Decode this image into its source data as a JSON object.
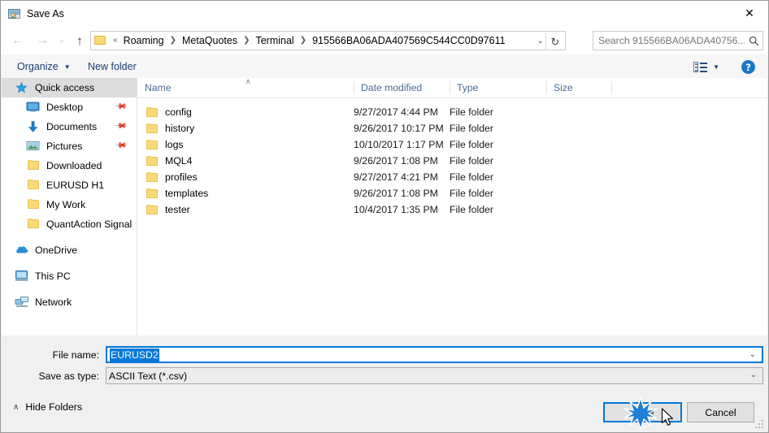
{
  "window": {
    "title": "Save As",
    "icon": "save-as-icon",
    "close_label": "✕"
  },
  "navigation": {
    "back_icon": "←",
    "forward_icon": "→",
    "recent_icon": "⌄",
    "up_icon": "↑",
    "breadcrumb": {
      "overflow": "«",
      "separator": "❯",
      "items": [
        "Roaming",
        "MetaQuotes",
        "Terminal",
        "915566BA06ADA407569C544CC0D97611"
      ],
      "dropdown_icon": "⌄",
      "refresh_icon": "↻"
    },
    "search": {
      "placeholder": "Search 915566BA06ADA40756...",
      "icon": "search-icon"
    }
  },
  "toolbar": {
    "organize_label": "Organize",
    "organize_caret": "▼",
    "new_folder_label": "New folder",
    "view_caret": "▼",
    "help_label": "?"
  },
  "sidebar": {
    "items": [
      {
        "label": "Quick access",
        "icon": "star-icon",
        "selected": true,
        "indent": false,
        "pinned": false
      },
      {
        "label": "Desktop",
        "icon": "desktop-icon",
        "selected": false,
        "indent": true,
        "pinned": true
      },
      {
        "label": "Documents",
        "icon": "documents-icon",
        "selected": false,
        "indent": true,
        "pinned": true
      },
      {
        "label": "Pictures",
        "icon": "pictures-icon",
        "selected": false,
        "indent": true,
        "pinned": true
      },
      {
        "label": "Downloaded",
        "icon": "folder-icon",
        "selected": false,
        "indent": true,
        "pinned": false
      },
      {
        "label": "EURUSD H1",
        "icon": "folder-icon",
        "selected": false,
        "indent": true,
        "pinned": false
      },
      {
        "label": "My Work",
        "icon": "folder-icon",
        "selected": false,
        "indent": true,
        "pinned": false
      },
      {
        "label": "QuantAction Signal",
        "icon": "folder-icon",
        "selected": false,
        "indent": true,
        "pinned": false
      },
      {
        "label": "OneDrive",
        "icon": "onedrive-icon",
        "selected": false,
        "indent": false,
        "pinned": false,
        "gap_before": true
      },
      {
        "label": "This PC",
        "icon": "this-pc-icon",
        "selected": false,
        "indent": false,
        "pinned": false,
        "gap_before": true
      },
      {
        "label": "Network",
        "icon": "network-icon",
        "selected": false,
        "indent": false,
        "pinned": false,
        "gap_before": true
      }
    ]
  },
  "file_list": {
    "columns": [
      "Name",
      "Date modified",
      "Type",
      "Size"
    ],
    "sort_indicator": "∧",
    "rows": [
      {
        "name": "config",
        "date": "9/27/2017 4:44 PM",
        "type": "File folder",
        "size": ""
      },
      {
        "name": "history",
        "date": "9/26/2017 10:17 PM",
        "type": "File folder",
        "size": ""
      },
      {
        "name": "logs",
        "date": "10/10/2017 1:17 PM",
        "type": "File folder",
        "size": ""
      },
      {
        "name": "MQL4",
        "date": "9/26/2017 1:08 PM",
        "type": "File folder",
        "size": ""
      },
      {
        "name": "profiles",
        "date": "9/27/2017 4:21 PM",
        "type": "File folder",
        "size": ""
      },
      {
        "name": "templates",
        "date": "9/26/2017 1:08 PM",
        "type": "File folder",
        "size": ""
      },
      {
        "name": "tester",
        "date": "10/4/2017 1:35 PM",
        "type": "File folder",
        "size": ""
      }
    ]
  },
  "form": {
    "file_name_label": "File name:",
    "file_name_value": "EURUSD2",
    "save_as_type_label": "Save as type:",
    "save_as_type_value": "ASCII Text (*.csv)",
    "dropdown_icon": "⌄"
  },
  "footer": {
    "hide_folders_label": "Hide Folders",
    "hide_folders_caret": "∧",
    "save_label": "Save",
    "cancel_label": "Cancel"
  },
  "colors": {
    "accent": "#0078d7",
    "breadcrumb_text": "#000000",
    "toolbar_link": "#1b3f73",
    "column_header": "#4a6a96",
    "folder_yellow": "#fbd976",
    "selection_gray": "#dcdcdc"
  }
}
